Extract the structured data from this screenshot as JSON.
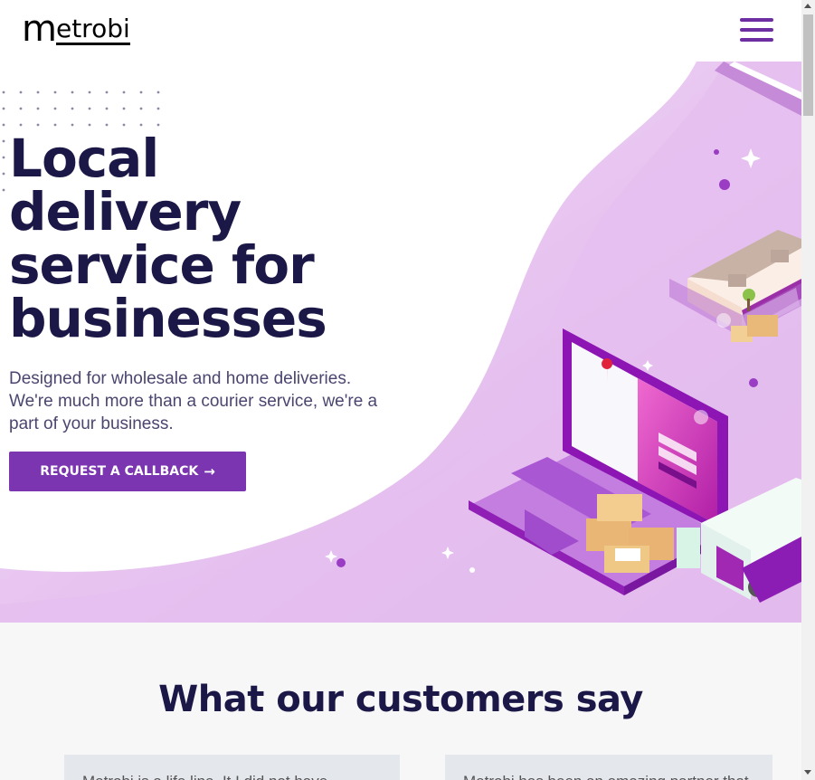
{
  "header": {
    "logo_m": "m",
    "logo_rest": "etrobi",
    "menu_icon": "hamburger-menu-icon"
  },
  "hero": {
    "title": "Local delivery service for businesses",
    "subtitle": "Designed for wholesale and home deliveries. We're much more than a courier service, we're a part of your business.",
    "cta_label": "REQUEST A CALLBACK",
    "cta_icon": "arrow-right-icon"
  },
  "testimonials": {
    "title": "What our customers say",
    "cards": [
      {
        "text": "Metrobi is a life line. It I did not have"
      },
      {
        "text": "Metrobi has been an amazing partner that"
      }
    ]
  },
  "colors": {
    "accent": "#7b35b0",
    "menu": "#6c2ea1",
    "heading": "#1b1747",
    "hero_bg": "#e7c7f0"
  }
}
